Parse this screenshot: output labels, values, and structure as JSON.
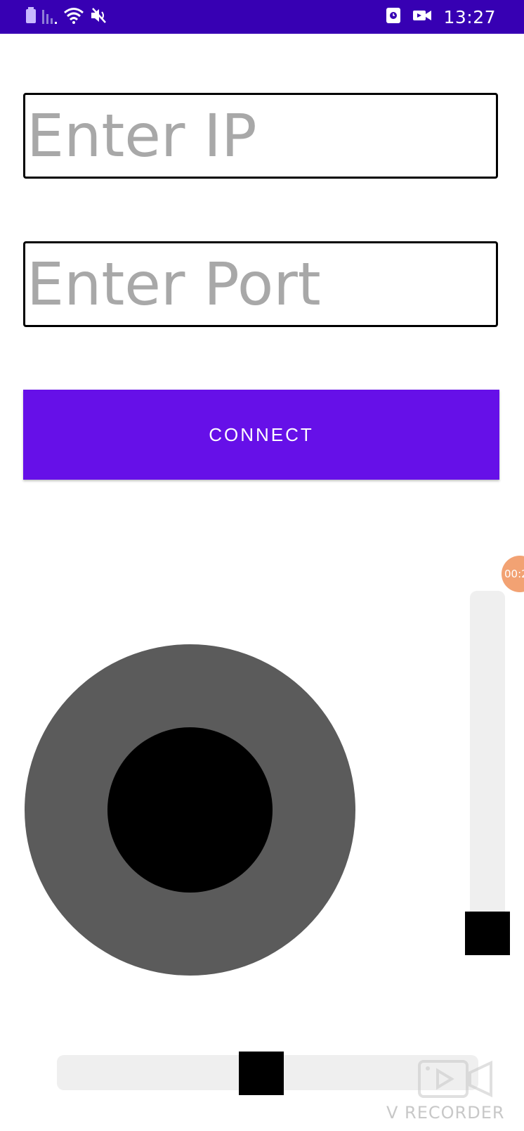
{
  "status_bar": {
    "time": "13:27",
    "icons_left": [
      "battery-icon",
      "signal-icon",
      "wifi-icon",
      "mute-icon"
    ],
    "icons_right": [
      "screen-record-icon",
      "video-icon"
    ]
  },
  "form": {
    "ip_placeholder": "Enter IP",
    "ip_value": "",
    "port_placeholder": "Enter Port",
    "port_value": "",
    "connect_label": "CONNECT"
  },
  "colors": {
    "status_bar": "#3700b3",
    "primary_button": "#6610e8",
    "joystick_base": "#5b5b5b",
    "joystick_knob": "#000000",
    "slider_track": "#efefef"
  },
  "recorder": {
    "timer": "00:2",
    "watermark": "V RECORDER"
  }
}
